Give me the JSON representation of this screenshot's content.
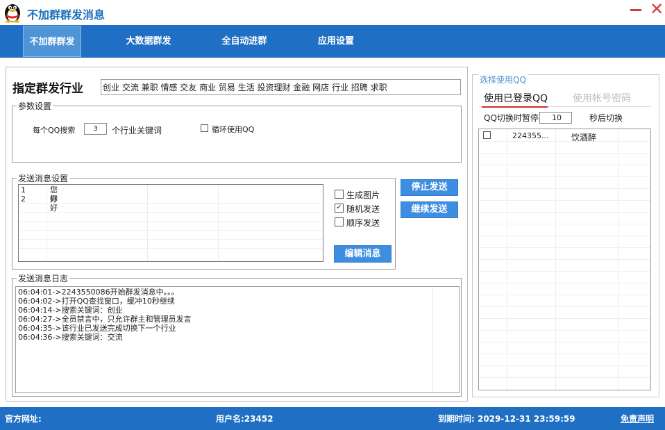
{
  "app": {
    "title": "不加群群发消息",
    "logo_icon": "qq-penguin-icon"
  },
  "nav": {
    "tabs": [
      {
        "label": "不加群群发",
        "active": true
      },
      {
        "label": "大数据群发"
      },
      {
        "label": "全自动进群"
      },
      {
        "label": "应用设置"
      }
    ]
  },
  "industry": {
    "label": "指定群发行业",
    "value": "创业 交流 兼职 情感 交友 商业 贸易 生活 投资理财 金融 网店 行业 招聘 求职"
  },
  "params": {
    "legend": "参数设置",
    "per_qq_label": "每个QQ搜索",
    "keyword_count": "3",
    "keyword_suffix": "个行业关键词",
    "loop_label": "循环使用QQ",
    "loop_checked": false
  },
  "send": {
    "legend": "发送消息设置",
    "messages": [
      {
        "index": "1",
        "text": "您好"
      },
      {
        "index": "2",
        "text": "你好"
      }
    ],
    "opt_generate_image": "生成图片",
    "opt_random": "随机发送",
    "opt_sequential": "顺序发送",
    "opt_random_checked": true,
    "stop_label": "停止发送",
    "continue_label": "继续发送",
    "edit_label": "编辑消息"
  },
  "log": {
    "legend": "发送消息日志",
    "lines": [
      "06:04:01->2243550086开始群发消息中。。。",
      "06:04:02->打开QQ查找窗口，缓冲10秒继续",
      "06:04:14->搜索关键词：创业",
      "06:04:27->全员禁言中，只允许群主和管理员发言",
      "06:04:35->该行业已发送完成切换下一个行业",
      "06:04:36->搜索关键词：交流"
    ]
  },
  "accounts": {
    "legend": "选择使用QQ",
    "tab_logged_in": "使用已登录QQ",
    "tab_password": "使用帐号密码",
    "switch_label": "QQ切换时暂停",
    "switch_value": "10",
    "switch_suffix": "秒后切换",
    "rows": [
      {
        "id": "224355...",
        "nick": "饮酒醉"
      }
    ]
  },
  "status": {
    "site_label": "官方网址:",
    "user_label": "用户名:23452",
    "expire_label": "到期时间: 2029-12-31 23:59:59",
    "disclaimer": "免责声明"
  },
  "colors": {
    "brand_blue": "#1f6fc4",
    "button_blue": "#3d8de0",
    "active_underline": "#d42b2b",
    "close_red": "#d43a3a"
  }
}
